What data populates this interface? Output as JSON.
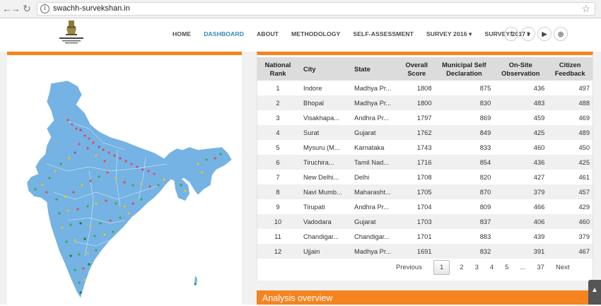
{
  "browser": {
    "url": "swachh-survekshan.in"
  },
  "header": {
    "nav": [
      {
        "label": "HOME"
      },
      {
        "label": "DASHBOARD",
        "active": true
      },
      {
        "label": "ABOUT"
      },
      {
        "label": "METHODOLOGY"
      },
      {
        "label": "SELF-ASSESSMENT"
      },
      {
        "label": "SURVEY 2016 ▾"
      },
      {
        "label": "SURVEY 2017 ▾"
      }
    ],
    "social": [
      {
        "icon": "facebook-icon",
        "glyph": "f"
      },
      {
        "icon": "twitter-icon",
        "glyph": "t"
      },
      {
        "icon": "youtube-icon",
        "glyph": "▶"
      },
      {
        "icon": "instagram-icon",
        "glyph": "◎"
      }
    ]
  },
  "colors": {
    "accent": "#f5841f",
    "active_nav": "#2c89b8",
    "map_fill": "#74b3e3"
  },
  "table": {
    "headers": [
      "National Rank",
      "City",
      "State",
      "Overall Score",
      "Municipal Self Declaration",
      "On-Site Observation",
      "Citizen Feedback"
    ],
    "rows": [
      [
        "1",
        "Indore",
        "Madhya Pr...",
        "1808",
        "875",
        "436",
        "497"
      ],
      [
        "2",
        "Bhopal",
        "Madhya Pr...",
        "1800",
        "830",
        "483",
        "488"
      ],
      [
        "3",
        "Visakhapa...",
        "Andhra Pr...",
        "1797",
        "869",
        "459",
        "469"
      ],
      [
        "4",
        "Surat",
        "Gujarat",
        "1762",
        "849",
        "425",
        "489"
      ],
      [
        "5",
        "Mysuru (M...",
        "Karnataka",
        "1743",
        "833",
        "460",
        "450"
      ],
      [
        "6",
        "Tiruchira...",
        "Tamil Nad...",
        "1716",
        "854",
        "436",
        "425"
      ],
      [
        "7",
        "New Delhi...",
        "Delhi",
        "1708",
        "820",
        "427",
        "461"
      ],
      [
        "8",
        "Navi Mumb...",
        "Maharasht...",
        "1705",
        "870",
        "379",
        "457"
      ],
      [
        "9",
        "Tirupati",
        "Andhra Pr...",
        "1704",
        "809",
        "466",
        "429"
      ],
      [
        "10",
        "Vadodara",
        "Gujarat",
        "1703",
        "837",
        "406",
        "460"
      ],
      [
        "11",
        "Chandigar...",
        "Chandigar...",
        "1701",
        "883",
        "439",
        "379"
      ],
      [
        "12",
        "Ujjain",
        "Madhya Pr...",
        "1691",
        "832",
        "391",
        "467"
      ]
    ]
  },
  "pagination": {
    "previous": "Previous",
    "pages": [
      "1",
      "2",
      "3",
      "4",
      "5",
      "...",
      "37"
    ],
    "current": "1",
    "next": "Next"
  },
  "analysis": {
    "title": "Analysis overview"
  }
}
